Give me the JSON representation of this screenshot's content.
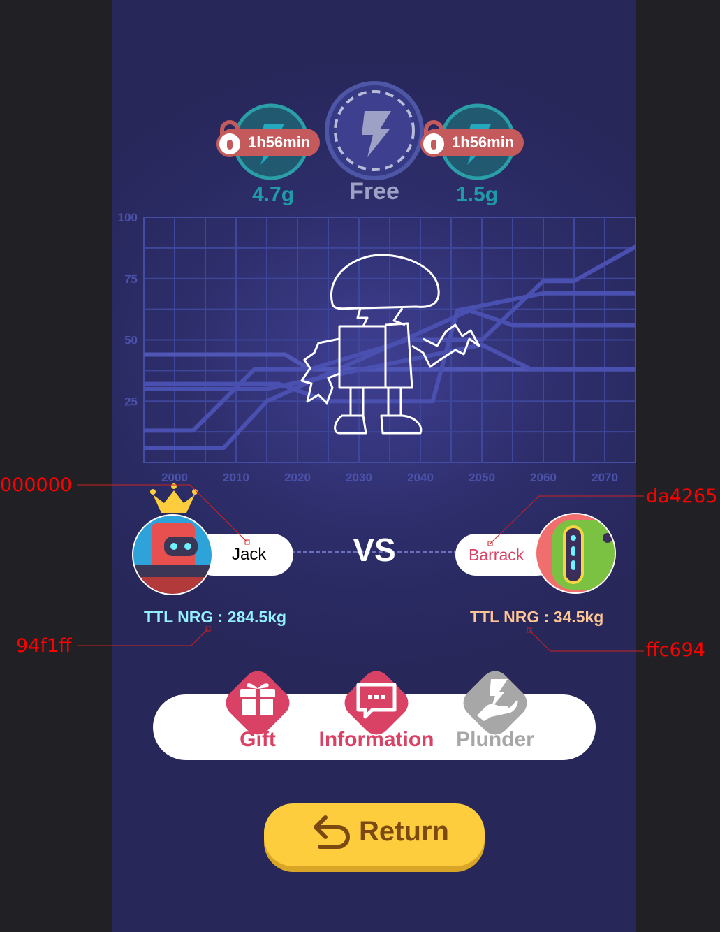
{
  "top_resources": {
    "left": {
      "timer": "1h56min",
      "amount": "4.7g"
    },
    "center": {
      "label": "Free"
    },
    "right": {
      "timer": "1h56min",
      "amount": "1.5g"
    }
  },
  "chart_data": {
    "type": "line",
    "x_ticks": [
      "2000",
      "2010",
      "2020",
      "2030",
      "2040",
      "2050",
      "2060",
      "2070"
    ],
    "y_ticks": [
      "100",
      "75",
      "50",
      "25"
    ],
    "ylim": [
      0,
      100
    ],
    "xlim": [
      1995,
      2075
    ],
    "grid": true,
    "series": [
      {
        "x": [
          1995,
          2018,
          2022,
          2060,
          2075
        ],
        "y": [
          44,
          44,
          38,
          38,
          38
        ],
        "color": "#5056b6"
      },
      {
        "x": [
          1995,
          2003,
          2013,
          2022,
          2038,
          2050,
          2060,
          2065,
          2075
        ],
        "y": [
          13,
          13,
          38,
          38,
          50,
          50,
          74,
          74,
          88
        ],
        "color": "#4a50b0"
      },
      {
        "x": [
          1995,
          2017,
          2025,
          2042,
          2046,
          2060,
          2075
        ],
        "y": [
          32,
          32,
          25,
          25,
          62,
          69,
          69
        ],
        "color": "#4a50b0"
      },
      {
        "x": [
          1995,
          2008,
          2015,
          2048,
          2055,
          2075
        ],
        "y": [
          6,
          6,
          25,
          62,
          56,
          56
        ],
        "color": "#4a50b0"
      },
      {
        "x": [
          1995,
          2015,
          2050,
          2058,
          2075
        ],
        "y": [
          30,
          30,
          48,
          38,
          38
        ],
        "color": "#4a50b0"
      }
    ]
  },
  "player_left": {
    "name": "Jack",
    "energy": "TTL NRG : 284.5kg",
    "energy_color": "#94f1ff"
  },
  "player_right": {
    "name": "Barrack",
    "name_color": "#da4265",
    "energy": "TTL NRG : 34.5kg",
    "energy_color": "#ffc694"
  },
  "vs_label": "VS",
  "actions": [
    {
      "label": "Gift",
      "icon": "gift-icon",
      "color": "#da4265"
    },
    {
      "label": "Information",
      "icon": "chat-icon",
      "color": "#da4265"
    },
    {
      "label": "Plunder",
      "icon": "plunder-hand-icon",
      "color": "#a7a7a7"
    }
  ],
  "return_button": {
    "label": "Return",
    "icon": "return-arrow-icon",
    "color": "#fecd3d"
  },
  "annotations": {
    "left_name_color": "000000",
    "left_energy_color": "94f1ff",
    "right_name_color": "da4265",
    "right_energy_color": "ffc694"
  }
}
